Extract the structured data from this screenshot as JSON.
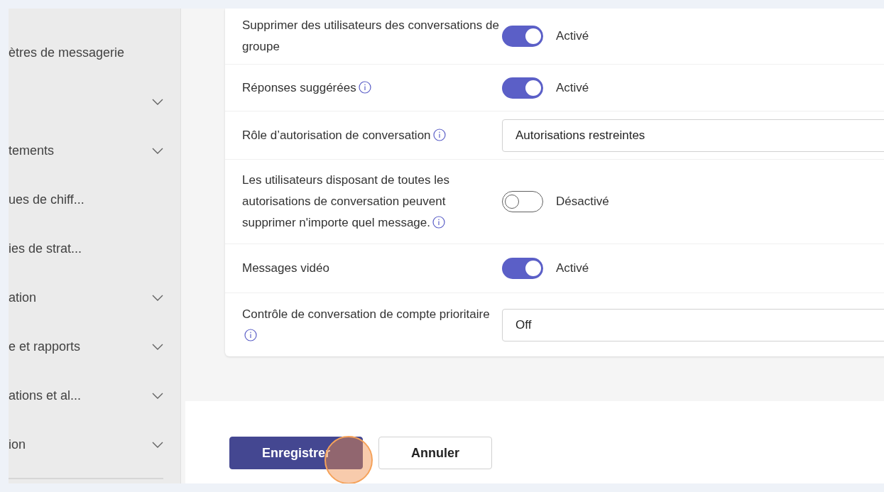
{
  "sidebar": {
    "items": [
      {
        "label": "ètres de messagerie",
        "expandable": false
      },
      {
        "expandable": true
      },
      {
        "label": "tements",
        "expandable": true
      },
      {
        "label": "ues de chiff...",
        "expandable": false
      },
      {
        "label": "ies de strat...",
        "expandable": false
      },
      {
        "label": "ation",
        "expandable": true
      },
      {
        "label": "e et rapports",
        "expandable": true
      },
      {
        "label": "ations et al...",
        "expandable": true
      },
      {
        "label": "ion",
        "expandable": true
      }
    ]
  },
  "settings": [
    {
      "kind": "toggle",
      "label": "Supprimer des utilisateurs des conversations de groupe",
      "info": false,
      "on": true,
      "state_text": "Activé"
    },
    {
      "kind": "toggle",
      "label": "Réponses suggérées",
      "info": true,
      "on": true,
      "state_text": "Activé"
    },
    {
      "kind": "dropdown",
      "label": "Rôle d’autorisation de conversation",
      "info": true,
      "value": "Autorisations restreintes"
    },
    {
      "kind": "toggle",
      "label": "Les utilisateurs disposant de toutes les autorisations de conversation peuvent supprimer n'importe quel message.",
      "info": true,
      "on": false,
      "state_text": "Désactivé"
    },
    {
      "kind": "toggle",
      "label": "Messages vidéo",
      "info": false,
      "on": true,
      "state_text": "Activé"
    },
    {
      "kind": "dropdown",
      "label": "Contrôle de conversation de compte prioritaire",
      "info": true,
      "value": "Off"
    }
  ],
  "footer": {
    "buttons": [
      {
        "label": "Enregistrer",
        "kind": "primary"
      },
      {
        "label": "Annuler",
        "kind": "secondary"
      }
    ]
  }
}
